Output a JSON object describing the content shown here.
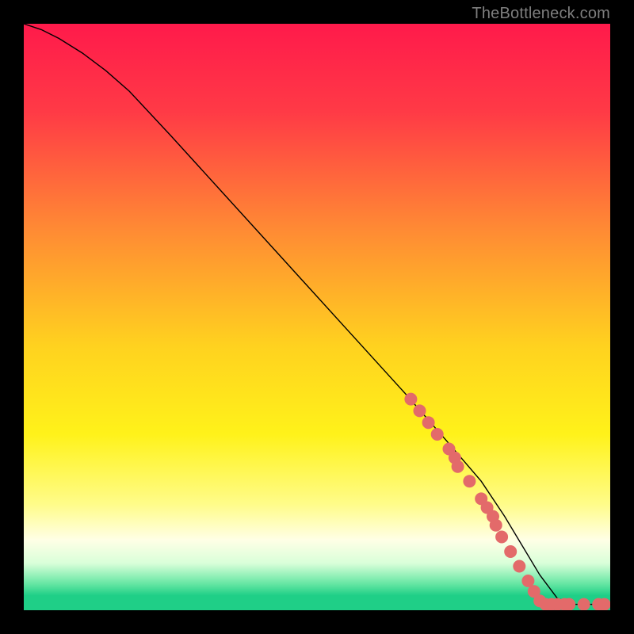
{
  "watermark": "TheBottleneck.com",
  "chart_data": {
    "type": "line",
    "title": "",
    "xlabel": "",
    "ylabel": "",
    "xlim": [
      0,
      100
    ],
    "ylim": [
      0,
      100
    ],
    "grid": false,
    "legend": false,
    "background_gradient": {
      "stops": [
        {
          "offset": 0.0,
          "color": "#ff1a4b"
        },
        {
          "offset": 0.15,
          "color": "#ff3a46"
        },
        {
          "offset": 0.35,
          "color": "#ff8a34"
        },
        {
          "offset": 0.55,
          "color": "#ffd21f"
        },
        {
          "offset": 0.7,
          "color": "#fff21a"
        },
        {
          "offset": 0.82,
          "color": "#fffc8a"
        },
        {
          "offset": 0.88,
          "color": "#ffffe6"
        },
        {
          "offset": 0.92,
          "color": "#d9ffd9"
        },
        {
          "offset": 0.955,
          "color": "#66e6a3"
        },
        {
          "offset": 0.975,
          "color": "#1fcf87"
        },
        {
          "offset": 1.0,
          "color": "#1fcf87"
        }
      ]
    },
    "series": [
      {
        "name": "bottleneck-curve",
        "color": "#000000",
        "stroke_width": 1.4,
        "x": [
          0,
          3,
          6,
          10,
          14,
          18,
          25,
          35,
          45,
          55,
          65,
          72,
          78,
          82,
          85,
          88,
          91,
          94,
          97,
          100
        ],
        "y": [
          100,
          99,
          97.5,
          95,
          92,
          88.5,
          81,
          70,
          59,
          48,
          37,
          29,
          22,
          16,
          11,
          6,
          2,
          1,
          1,
          1
        ]
      }
    ],
    "scatter": {
      "name": "sample-points",
      "color": "#e36a6a",
      "radius": 8,
      "points": [
        {
          "x": 66,
          "y": 36
        },
        {
          "x": 67.5,
          "y": 34
        },
        {
          "x": 69,
          "y": 32
        },
        {
          "x": 70.5,
          "y": 30
        },
        {
          "x": 72.5,
          "y": 27.5
        },
        {
          "x": 73.5,
          "y": 26
        },
        {
          "x": 74,
          "y": 24.5
        },
        {
          "x": 76,
          "y": 22
        },
        {
          "x": 78,
          "y": 19
        },
        {
          "x": 79,
          "y": 17.5
        },
        {
          "x": 80,
          "y": 16
        },
        {
          "x": 80.5,
          "y": 14.5
        },
        {
          "x": 81.5,
          "y": 12.5
        },
        {
          "x": 83,
          "y": 10
        },
        {
          "x": 84.5,
          "y": 7.5
        },
        {
          "x": 86,
          "y": 5
        },
        {
          "x": 87,
          "y": 3.2
        },
        {
          "x": 88,
          "y": 1.6
        },
        {
          "x": 89,
          "y": 1
        },
        {
          "x": 90,
          "y": 1
        },
        {
          "x": 91,
          "y": 1
        },
        {
          "x": 92.2,
          "y": 1
        },
        {
          "x": 93,
          "y": 1
        },
        {
          "x": 95.5,
          "y": 1
        },
        {
          "x": 98,
          "y": 1
        },
        {
          "x": 99,
          "y": 1
        }
      ]
    }
  }
}
